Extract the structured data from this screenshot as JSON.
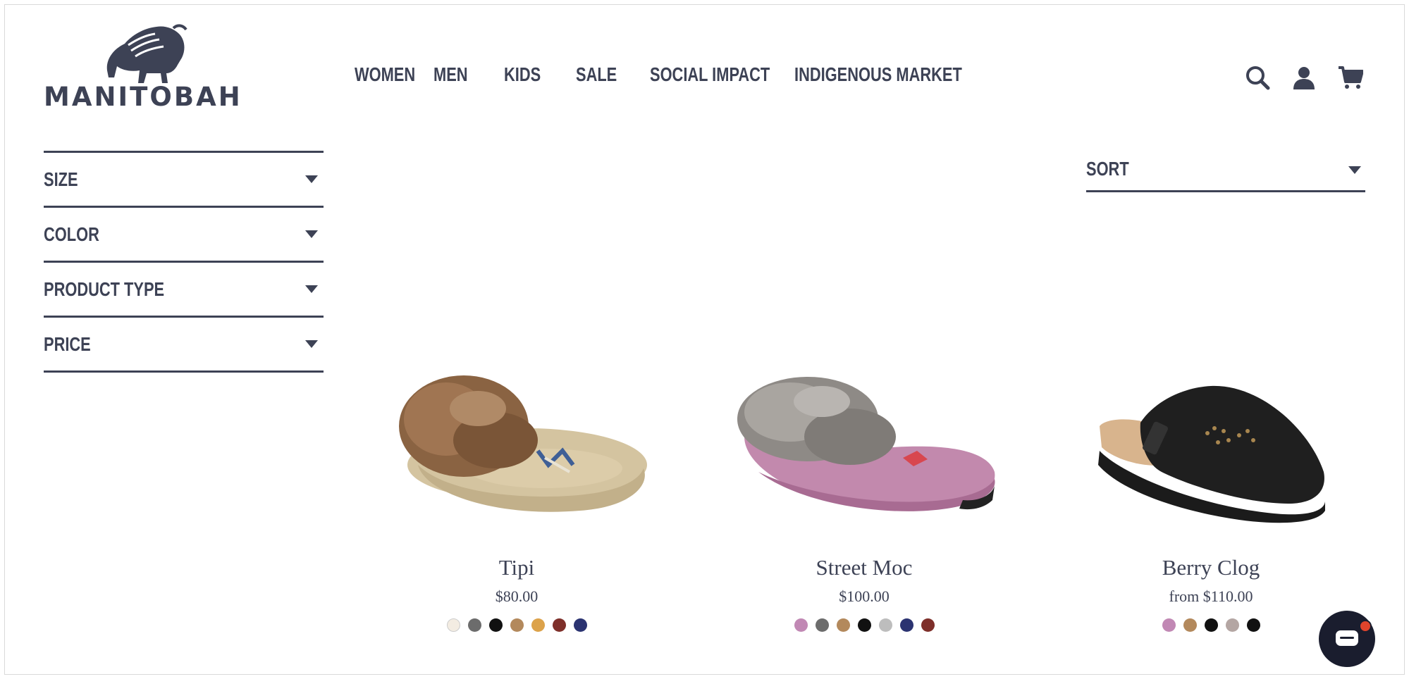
{
  "brand": {
    "name": "MANITOBAH"
  },
  "nav": [
    "WOMEN",
    "MEN",
    "KIDS",
    "SALE",
    "SOCIAL IMPACT",
    "INDIGENOUS MARKET"
  ],
  "header_icons": [
    "search-icon",
    "account-icon",
    "cart-icon"
  ],
  "filters": [
    "SIZE",
    "COLOR",
    "PRODUCT TYPE",
    "PRICE"
  ],
  "sort": {
    "label": "SORT"
  },
  "products": [
    {
      "name": "Tipi",
      "price": "$80.00",
      "swatches": [
        "#f3ece2",
        "#6c6c6c",
        "#111111",
        "#b3895c",
        "#dca24a",
        "#7e2f2a",
        "#2b3371"
      ]
    },
    {
      "name": "Street Moc",
      "price": "$100.00",
      "swatches": [
        "#c188b4",
        "#6c6c6c",
        "#b3895c",
        "#111111",
        "#bdbdbd",
        "#2b3371",
        "#7e2f2a"
      ]
    },
    {
      "name": "Berry Clog",
      "price": "from $110.00",
      "swatches": [
        "#c188b4",
        "#b3895c",
        "#111111",
        "#b4a6a3",
        "#111111"
      ]
    }
  ],
  "colors": {
    "primary": "#3d4255",
    "chat": "#1a1d2e",
    "badge": "#e0442c"
  }
}
